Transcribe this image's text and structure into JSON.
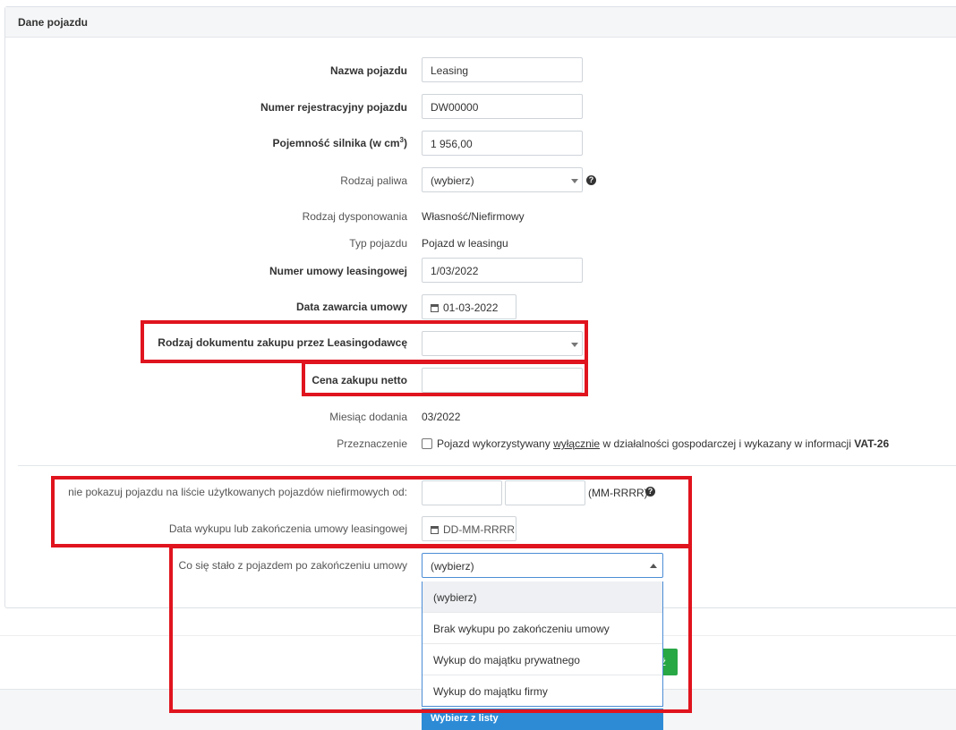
{
  "panel": {
    "title": "Dane pojazdu"
  },
  "form": {
    "vehicle_name": {
      "label": "Nazwa pojazdu",
      "value": "Leasing"
    },
    "registration": {
      "label": "Numer rejestracyjny pojazdu",
      "value": "DW00000"
    },
    "engine": {
      "label": "Pojemność silnika (w cm",
      "sup": "3",
      "label_end": ")",
      "value": "1 956,00"
    },
    "fuel": {
      "label": "Rodzaj paliwa",
      "value": "(wybierz)"
    },
    "disposal": {
      "label": "Rodzaj dysponowania",
      "value": "Własność/Niefirmowy"
    },
    "vehicle_type": {
      "label": "Typ pojazdu",
      "value": "Pojazd w leasingu"
    },
    "contract_no": {
      "label": "Numer umowy leasingowej",
      "value": "1/03/2022"
    },
    "contract_date": {
      "label": "Data zawarcia umowy",
      "value": "01-03-2022"
    },
    "purchase_doc": {
      "label": "Rodzaj dokumentu zakupu przez Leasingodawcę",
      "value": ""
    },
    "net_price": {
      "label": "Cena zakupu netto",
      "value": ""
    },
    "month_added": {
      "label": "Miesiąc dodania",
      "value": "03/2022"
    },
    "purpose": {
      "label": "Przeznaczenie",
      "text_pre": "Pojazd wykorzystywany",
      "text_underline": "wyłącznie",
      "text_mid": "w działalności gospodarczej i wykazany w informacji",
      "text_bold": "VAT-26"
    },
    "hide_from": {
      "label": "nie pokazuj pojazdu na liście użytkowanych pojazdów niefirmowych od:",
      "value1": "",
      "value2": "",
      "format_hint": "(MM-RRRR)"
    },
    "buyout_date": {
      "label": "Data wykupu lub zakończenia umowy leasingowej",
      "placeholder": "DD-MM-RRRR"
    },
    "after_contract": {
      "label": "Co się stało z pojazdem po zakończeniu umowy",
      "value": "(wybierz)",
      "options": [
        "(wybierz)",
        "Brak wykupu po zakończeniu umowy",
        "Wykup do majątku prywatnego",
        "Wykup do majątku firmy"
      ]
    }
  },
  "footer": {
    "save_partial": "ź",
    "tooltip": "Wybierz z listy"
  },
  "colors": {
    "highlight_red": "#e0141e",
    "save_green": "#28a745",
    "tooltip_blue": "#2d8bd6"
  },
  "icons": [
    "help-icon",
    "calendar-icon",
    "chevron-down-icon",
    "chevron-up-icon"
  ]
}
